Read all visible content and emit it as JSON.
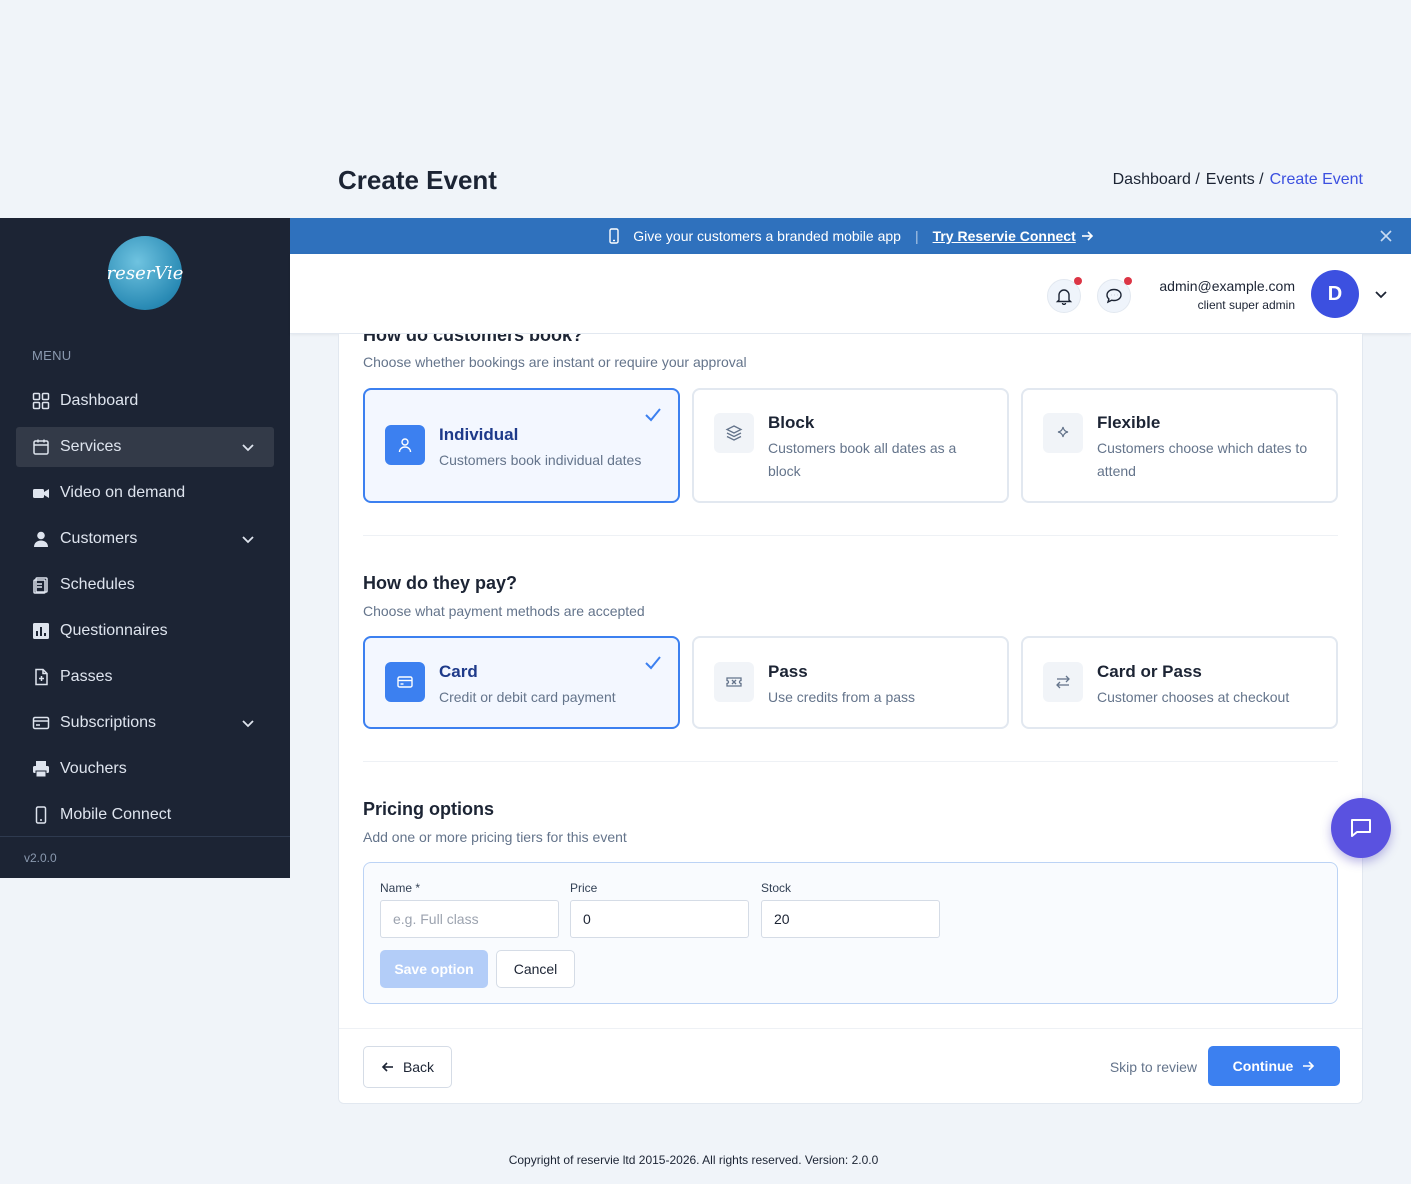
{
  "header": {
    "title": "Create Event",
    "breadcrumb": [
      "Dashboard /",
      "Events /",
      "Create Event"
    ]
  },
  "sidebar": {
    "logo_text": "reserVie",
    "menu_label": "MENU",
    "items": [
      {
        "label": "Dashboard",
        "icon": "grid-icon"
      },
      {
        "label": "Services",
        "icon": "calendar-icon",
        "expandable": true,
        "active": true
      },
      {
        "label": "Video on demand",
        "icon": "video-icon"
      },
      {
        "label": "Customers",
        "icon": "user-icon",
        "expandable": true
      },
      {
        "label": "Schedules",
        "icon": "clipboard-icon"
      },
      {
        "label": "Questionnaires",
        "icon": "chart-icon"
      },
      {
        "label": "Passes",
        "icon": "pass-icon"
      },
      {
        "label": "Subscriptions",
        "icon": "card-icon",
        "expandable": true
      },
      {
        "label": "Vouchers",
        "icon": "printer-icon"
      },
      {
        "label": "Mobile Connect",
        "icon": "phone-icon"
      }
    ],
    "version": "v2.0.0"
  },
  "promo": {
    "text": "Give your customers a branded mobile app",
    "link": "Try Reservie Connect",
    "separator": "|"
  },
  "topbar": {
    "email": "admin@example.com",
    "role": "client super admin",
    "avatar_initial": "D"
  },
  "booking": {
    "title": "How do customers book?",
    "subtitle": "Choose whether bookings are instant or require your approval",
    "options": [
      {
        "title": "Individual",
        "desc": "Customers book individual dates",
        "selected": true,
        "icon": "person-icon"
      },
      {
        "title": "Block",
        "desc": "Customers book all dates as a block",
        "selected": false,
        "icon": "layers-icon"
      },
      {
        "title": "Flexible",
        "desc": "Customers choose which dates to attend",
        "selected": false,
        "icon": "sparkle-icon"
      }
    ]
  },
  "payment": {
    "title": "How do they pay?",
    "subtitle": "Choose what payment methods are accepted",
    "options": [
      {
        "title": "Card",
        "desc": "Credit or debit card payment",
        "selected": true,
        "icon": "credit-card-icon"
      },
      {
        "title": "Pass",
        "desc": "Use credits from a pass",
        "selected": false,
        "icon": "ticket-icon"
      },
      {
        "title": "Card or Pass",
        "desc": "Customer chooses at checkout",
        "selected": false,
        "icon": "swap-icon"
      }
    ]
  },
  "pricing": {
    "title": "Pricing options",
    "subtitle": "Add one or more pricing tiers for this event",
    "name_label": "Name *",
    "name_placeholder": "e.g. Full class",
    "name_value": "",
    "price_label": "Price",
    "price_value": "0",
    "stock_label": "Stock",
    "stock_value": "20",
    "save_label": "Save option",
    "cancel_label": "Cancel"
  },
  "footer": {
    "back_label": "Back",
    "skip_label": "Skip to review",
    "continue_label": "Continue"
  },
  "copyright": "Copyright of reservie ltd 2015-2026. All rights reserved. Version: 2.0.0",
  "colors": {
    "sidebar_bg": "#1c2434",
    "accent": "#3c80f0",
    "promo_bg": "#2f71bd",
    "avatar_bg": "#3c50e0",
    "chat_fab": "#5a52e0"
  }
}
